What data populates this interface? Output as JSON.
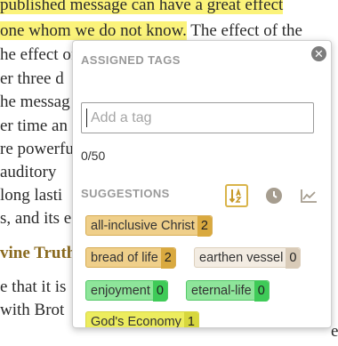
{
  "article": {
    "lines": [
      {
        "pre": "",
        "hl": "published message can have a great effect",
        "post": ""
      },
      {
        "pre": "",
        "hl": "one whom we do not know.",
        "post": " The effect of the"
      },
      {
        "pre": "he effect of",
        "hl": "",
        "post": ""
      },
      {
        "pre": "er three d",
        "hl": "",
        "post": ""
      },
      {
        "pre": "he messag",
        "hl": "",
        "post": ""
      },
      {
        "pre": "er time an",
        "hl": "",
        "post": ""
      },
      {
        "pre": "re powerfu",
        "hl": "",
        "post": ""
      },
      {
        "pre": "auditory",
        "hl": "",
        "post": ""
      },
      {
        "pre": "long lasti",
        "hl": "",
        "post": ""
      },
      {
        "pre": "s, and its e",
        "hl": "",
        "post": ""
      },
      {
        "heading": "vine Truth",
        "pre": "",
        "hl": "",
        "post": ""
      },
      {
        "pre": "e that it is",
        "hl": "",
        "post": ""
      },
      {
        "pre": "with Brot",
        "hl": "",
        "post": ""
      },
      {
        "pre": "",
        "hl": "",
        "post": "e of the truth. If our publications had not"
      }
    ]
  },
  "tags_panel": {
    "assigned_title": "ASSIGNED TAGS",
    "input_placeholder": "Add a tag",
    "input_value": "",
    "count_text": "0/50",
    "suggestions_title": "SUGGESTIONS",
    "sort_icons": [
      "sort-alpha-icon",
      "clock-icon",
      "trend-chart-icon"
    ],
    "suggestions": [
      {
        "label": "all-inclusive Christ",
        "count": "2",
        "style": "gold"
      },
      {
        "label": "bread of life",
        "count": "2",
        "style": "gold"
      },
      {
        "label": "earthen vessel",
        "count": "0",
        "style": "beige"
      },
      {
        "label": "enjoyment",
        "count": "0",
        "style": "green"
      },
      {
        "label": "eternal-life",
        "count": "0",
        "style": "green"
      },
      {
        "label": "God's Economy",
        "count": "1",
        "style": "yellow"
      }
    ],
    "colors": {
      "accent": "#d9b44a",
      "highlight": "#fbf37a"
    }
  }
}
